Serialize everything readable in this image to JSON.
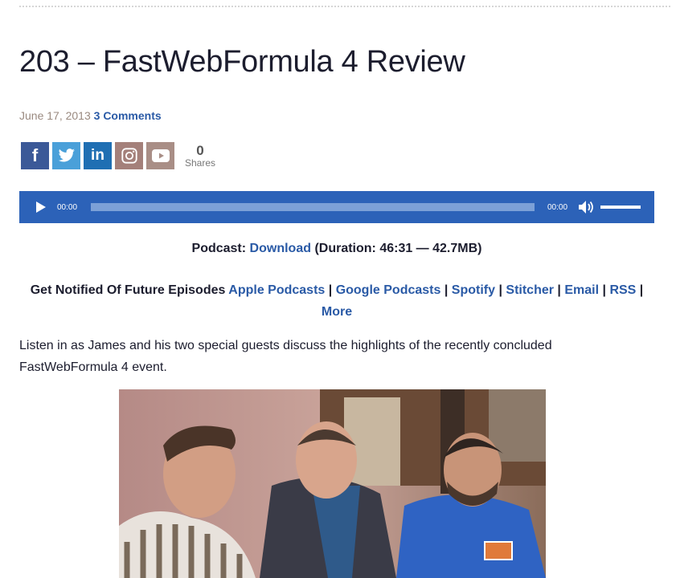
{
  "post": {
    "title": "203 – FastWebFormula 4 Review",
    "date": "June 17, 2013",
    "comments": "3 Comments"
  },
  "share": {
    "buttons": [
      {
        "name": "facebook",
        "glyph": "f",
        "icon": "facebook-icon"
      },
      {
        "name": "twitter",
        "glyph": "",
        "icon": "twitter-icon"
      },
      {
        "name": "linkedin",
        "glyph": "in",
        "icon": "linkedin-icon"
      },
      {
        "name": "instagram",
        "glyph": "",
        "icon": "instagram-icon"
      },
      {
        "name": "youtube",
        "glyph": "",
        "icon": "youtube-icon"
      }
    ],
    "count": "0",
    "count_label": "Shares"
  },
  "player": {
    "current_time": "00:00",
    "duration_time": "00:00",
    "progress": 0,
    "volume": 1.0,
    "color": "#2c62b8"
  },
  "podcast": {
    "label": "Podcast:",
    "download": "Download",
    "details": "(Duration: 46:31 — 42.7MB)"
  },
  "notify": {
    "label": "Get Notified Of Future Episodes",
    "links": [
      "Apple Podcasts",
      "Google Podcasts",
      "Spotify",
      "Stitcher",
      "Email",
      "RSS"
    ],
    "more": "More",
    "separator": "|"
  },
  "description": "Listen in as James and his two special guests discuss the highlights of the recently concluded FastWebFormula 4 event.",
  "colors": {
    "link": "#2a5aa6",
    "title": "#1c1d2e",
    "meta": "#9a8a80"
  }
}
